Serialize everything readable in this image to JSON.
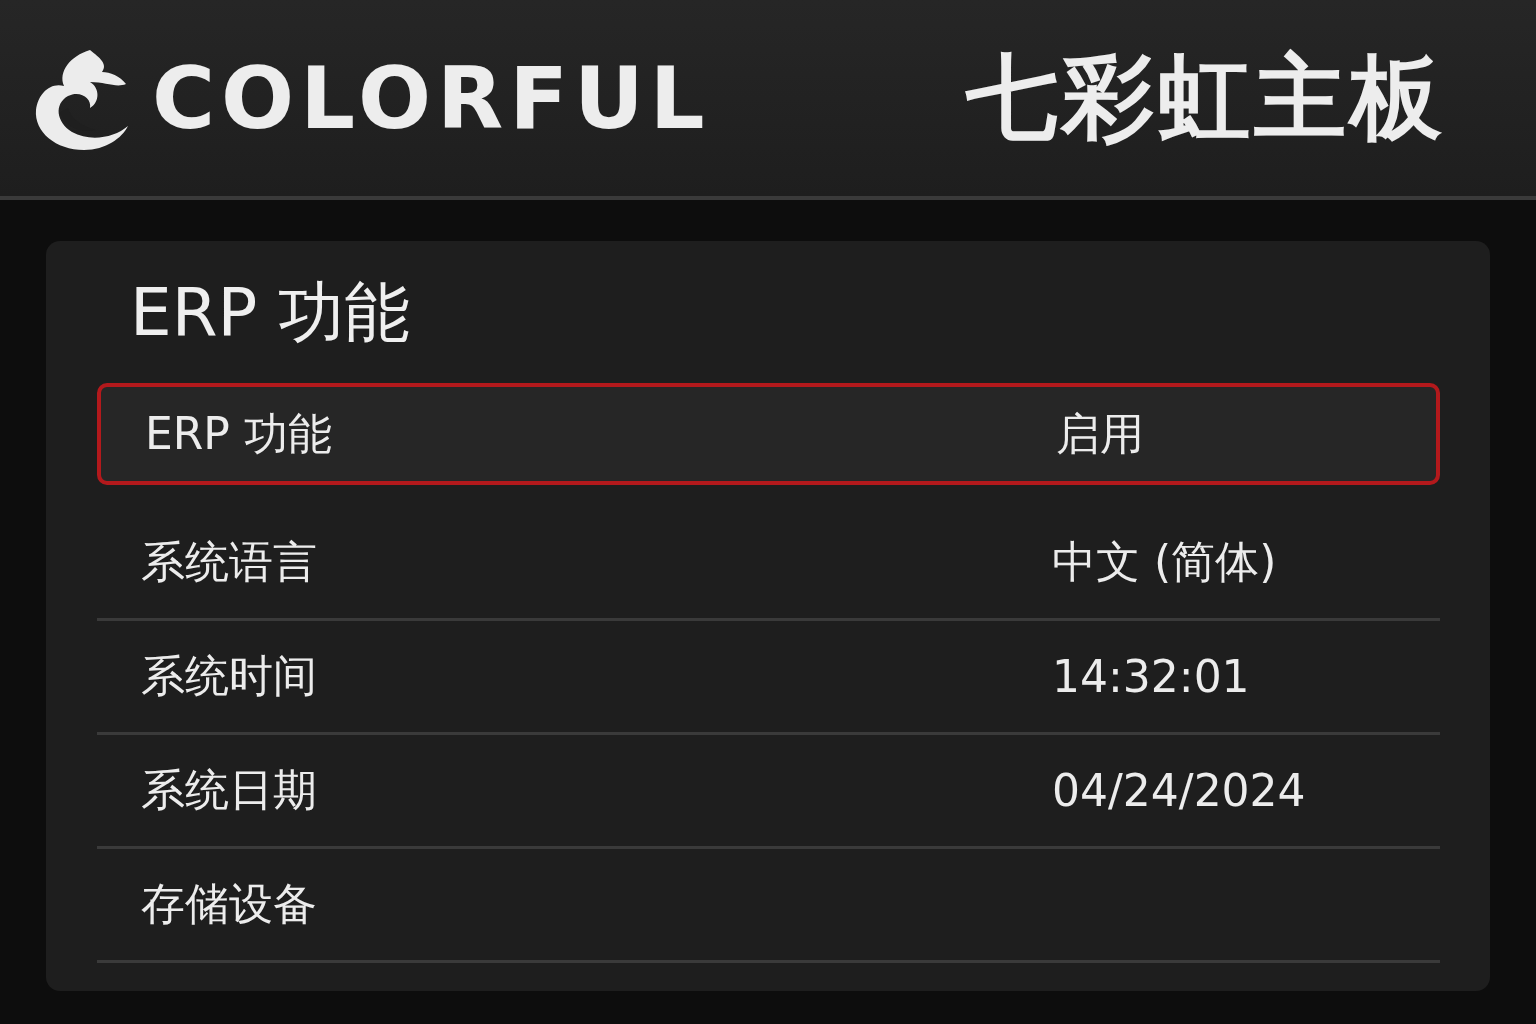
{
  "header": {
    "brand": "COLORFUL",
    "title": "七彩虹主板"
  },
  "panel": {
    "title": "ERP 功能",
    "rows": [
      {
        "label": "ERP 功能",
        "value": "启用",
        "selected": true
      },
      {
        "label": "系统语言",
        "value": "中文 (简体)",
        "selected": false
      },
      {
        "label": "系统时间",
        "value": "14:32:01",
        "selected": false
      },
      {
        "label": "系统日期",
        "value": "04/24/2024",
        "selected": false
      },
      {
        "label": "存储设备",
        "selected": false
      }
    ]
  }
}
